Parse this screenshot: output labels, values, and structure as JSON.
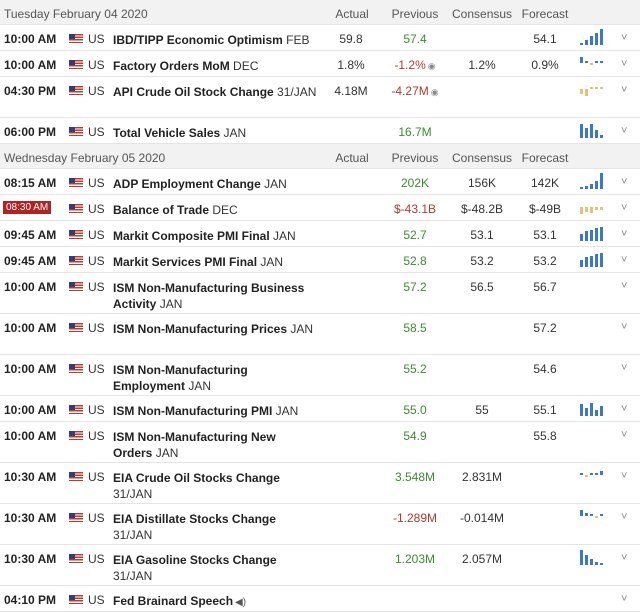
{
  "columns": {
    "actual": "Actual",
    "previous": "Previous",
    "consensus": "Consensus",
    "forecast": "Forecast"
  },
  "days": [
    {
      "date": "Tuesday February 04 2020",
      "events": [
        {
          "time": "10:00 AM",
          "country": "US",
          "name": "IBD/TIPP Economic Optimism",
          "period": "FEB",
          "actual": "59.8",
          "actual_class": "",
          "previous": "57.4",
          "previous_class": "green",
          "previous_revised": false,
          "consensus": "",
          "forecast": "54.1",
          "spark": {
            "color": "blue",
            "bars": [
              0.15,
              0.3,
              0.55,
              0.75,
              1.0
            ]
          },
          "chevron": "chevron-down-icon"
        },
        {
          "time": "10:00 AM",
          "country": "US",
          "name": "Factory Orders MoM",
          "period": "DEC",
          "actual": "1.8%",
          "actual_class": "",
          "previous": "-1.2%",
          "previous_class": "red",
          "previous_revised": true,
          "consensus": "1.2%",
          "forecast": "0.9%",
          "spark": {
            "color": "mixed",
            "bars": [
              0.7,
              0.3,
              -0.2,
              0.15,
              0.1
            ]
          },
          "chevron": "chevron-down-icon"
        },
        {
          "time": "04:30 PM",
          "country": "US",
          "name": "API Crude Oil Stock Change",
          "period": "31/JAN",
          "actual": "4.18M",
          "actual_class": "",
          "previous": "-4.27M",
          "previous_class": "red",
          "previous_revised": true,
          "consensus": "",
          "forecast": "",
          "spark": {
            "color": "tan",
            "bars": [
              -0.6,
              -0.9,
              0.2,
              0.1,
              0.2
            ]
          },
          "chevron": "chevron-down-icon"
        },
        {
          "time": "06:00 PM",
          "country": "US",
          "name": "Total Vehicle Sales",
          "period": "JAN",
          "actual": "",
          "actual_class": "",
          "previous": "16.7M",
          "previous_class": "green",
          "previous_revised": false,
          "consensus": "",
          "forecast": "",
          "spark": {
            "color": "blue",
            "bars": [
              0.9,
              0.6,
              0.9,
              0.5,
              0.2
            ]
          },
          "chevron": "chevron-down-icon"
        }
      ]
    },
    {
      "date": "Wednesday February 05 2020",
      "events": [
        {
          "time": "08:15 AM",
          "country": "US",
          "name": "ADP Employment Change",
          "period": "JAN",
          "actual": "",
          "actual_class": "",
          "previous": "202K",
          "previous_class": "green",
          "previous_revised": false,
          "consensus": "156K",
          "forecast": "142K",
          "spark": {
            "color": "blue",
            "bars": [
              0.1,
              0.2,
              0.3,
              0.5,
              1.0
            ]
          },
          "chevron": "chevron-down-icon"
        },
        {
          "time": "08:30 AM",
          "highlight": true,
          "country": "US",
          "name": "Balance of Trade",
          "period": "DEC",
          "actual": "",
          "actual_class": "",
          "previous": "$-43.1B",
          "previous_class": "red",
          "previous_revised": false,
          "consensus": "$-48.2B",
          "forecast": "$-49B",
          "spark": {
            "color": "tan",
            "bars": [
              -0.9,
              -0.6,
              -0.8,
              -0.4,
              -0.35
            ]
          },
          "chevron": "chevron-down-icon"
        },
        {
          "time": "09:45 AM",
          "country": "US",
          "name": "Markit Composite PMI Final",
          "period": "JAN",
          "actual": "",
          "actual_class": "",
          "previous": "52.7",
          "previous_class": "green",
          "previous_revised": false,
          "consensus": "53.1",
          "forecast": "53.1",
          "spark": {
            "color": "blue",
            "bars": [
              0.45,
              0.6,
              0.7,
              0.8,
              0.9
            ]
          },
          "chevron": "chevron-down-icon"
        },
        {
          "time": "09:45 AM",
          "country": "US",
          "name": "Markit Services PMI Final",
          "period": "JAN",
          "actual": "",
          "actual_class": "",
          "previous": "52.8",
          "previous_class": "green",
          "previous_revised": false,
          "consensus": "53.2",
          "forecast": "53.2",
          "spark": {
            "color": "blue",
            "bars": [
              0.45,
              0.6,
              0.7,
              0.8,
              0.9
            ]
          },
          "chevron": "chevron-down-icon"
        },
        {
          "time": "10:00 AM",
          "country": "US",
          "name": "ISM Non-Manufacturing Business Activity",
          "period": "JAN",
          "actual": "",
          "actual_class": "",
          "previous": "57.2",
          "previous_class": "green",
          "previous_revised": false,
          "consensus": "56.5",
          "forecast": "56.7",
          "spark": null,
          "chevron": "chevron-down-icon"
        },
        {
          "time": "10:00 AM",
          "country": "US",
          "name": "ISM Non-Manufacturing Prices",
          "period": "JAN",
          "actual": "",
          "actual_class": "",
          "previous": "58.5",
          "previous_class": "green",
          "previous_revised": false,
          "consensus": "",
          "forecast": "57.2",
          "spark": null,
          "chevron": "chevron-down-icon"
        },
        {
          "time": "10:00 AM",
          "country": "US",
          "name": "ISM Non-Manufacturing Employment",
          "period": "JAN",
          "actual": "",
          "actual_class": "",
          "previous": "55.2",
          "previous_class": "green",
          "previous_revised": false,
          "consensus": "",
          "forecast": "54.6",
          "spark": null,
          "chevron": "chevron-down-icon"
        },
        {
          "time": "10:00 AM",
          "country": "US",
          "name": "ISM Non-Manufacturing PMI",
          "period": "JAN",
          "actual": "",
          "actual_class": "",
          "previous": "55.0",
          "previous_class": "green",
          "previous_revised": false,
          "consensus": "55",
          "forecast": "55.1",
          "spark": {
            "color": "blue",
            "bars": [
              0.75,
              0.5,
              0.8,
              0.4,
              0.6
            ]
          },
          "chevron": "chevron-down-icon"
        },
        {
          "time": "10:00 AM",
          "country": "US",
          "name": "ISM Non-Manufacturing New Orders",
          "period": "JAN",
          "actual": "",
          "actual_class": "",
          "previous": "54.9",
          "previous_class": "green",
          "previous_revised": false,
          "consensus": "",
          "forecast": "55.8",
          "spark": null,
          "chevron": "chevron-down-icon"
        },
        {
          "time": "10:30 AM",
          "country": "US",
          "name": "EIA Crude Oil Stocks Change",
          "period": "31/JAN",
          "actual": "",
          "actual_class": "",
          "previous": "3.548M",
          "previous_class": "green",
          "previous_revised": false,
          "consensus": "2.831M",
          "forecast": "",
          "spark": {
            "color": "mixed",
            "bars": [
              0.2,
              -0.15,
              0.3,
              0.25,
              0.5
            ]
          },
          "chevron": "chevron-down-icon"
        },
        {
          "time": "10:30 AM",
          "country": "US",
          "name": "EIA Distillate Stocks Change",
          "period": "31/JAN",
          "actual": "",
          "actual_class": "",
          "previous": "-1.289M",
          "previous_class": "red",
          "previous_revised": false,
          "consensus": "-0.014M",
          "forecast": "",
          "spark": {
            "color": "mixed",
            "bars": [
              0.7,
              0.4,
              0.15,
              -0.2,
              0.1
            ]
          },
          "chevron": "chevron-down-icon"
        },
        {
          "time": "10:30 AM",
          "country": "US",
          "name": "EIA Gasoline Stocks Change",
          "period": "31/JAN",
          "actual": "",
          "actual_class": "",
          "previous": "1.203M",
          "previous_class": "green",
          "previous_revised": false,
          "consensus": "2.057M",
          "forecast": "",
          "spark": {
            "color": "blue",
            "bars": [
              0.95,
              0.6,
              0.4,
              0.2,
              0.1
            ]
          },
          "chevron": "chevron-down-icon"
        },
        {
          "time": "04:10 PM",
          "country": "US",
          "name": "Fed Brainard Speech",
          "period": "",
          "actual": "",
          "actual_class": "",
          "previous": "",
          "previous_class": "",
          "previous_revised": false,
          "consensus": "",
          "forecast": "",
          "speech": true,
          "spark": null,
          "chevron": "chevron-down-icon"
        }
      ]
    }
  ],
  "colors": {
    "positive": "#3c8c2e",
    "negative": "#b03a2e",
    "highlight_time": "#b22222",
    "spark_blue": "#3b78c5",
    "spark_tan": "#e9c07a"
  },
  "icons": {
    "flag": "us-flag-icon",
    "revision": "revision-circle-icon",
    "speaker": "speaker-icon",
    "chevron": "chevron-down-icon"
  }
}
